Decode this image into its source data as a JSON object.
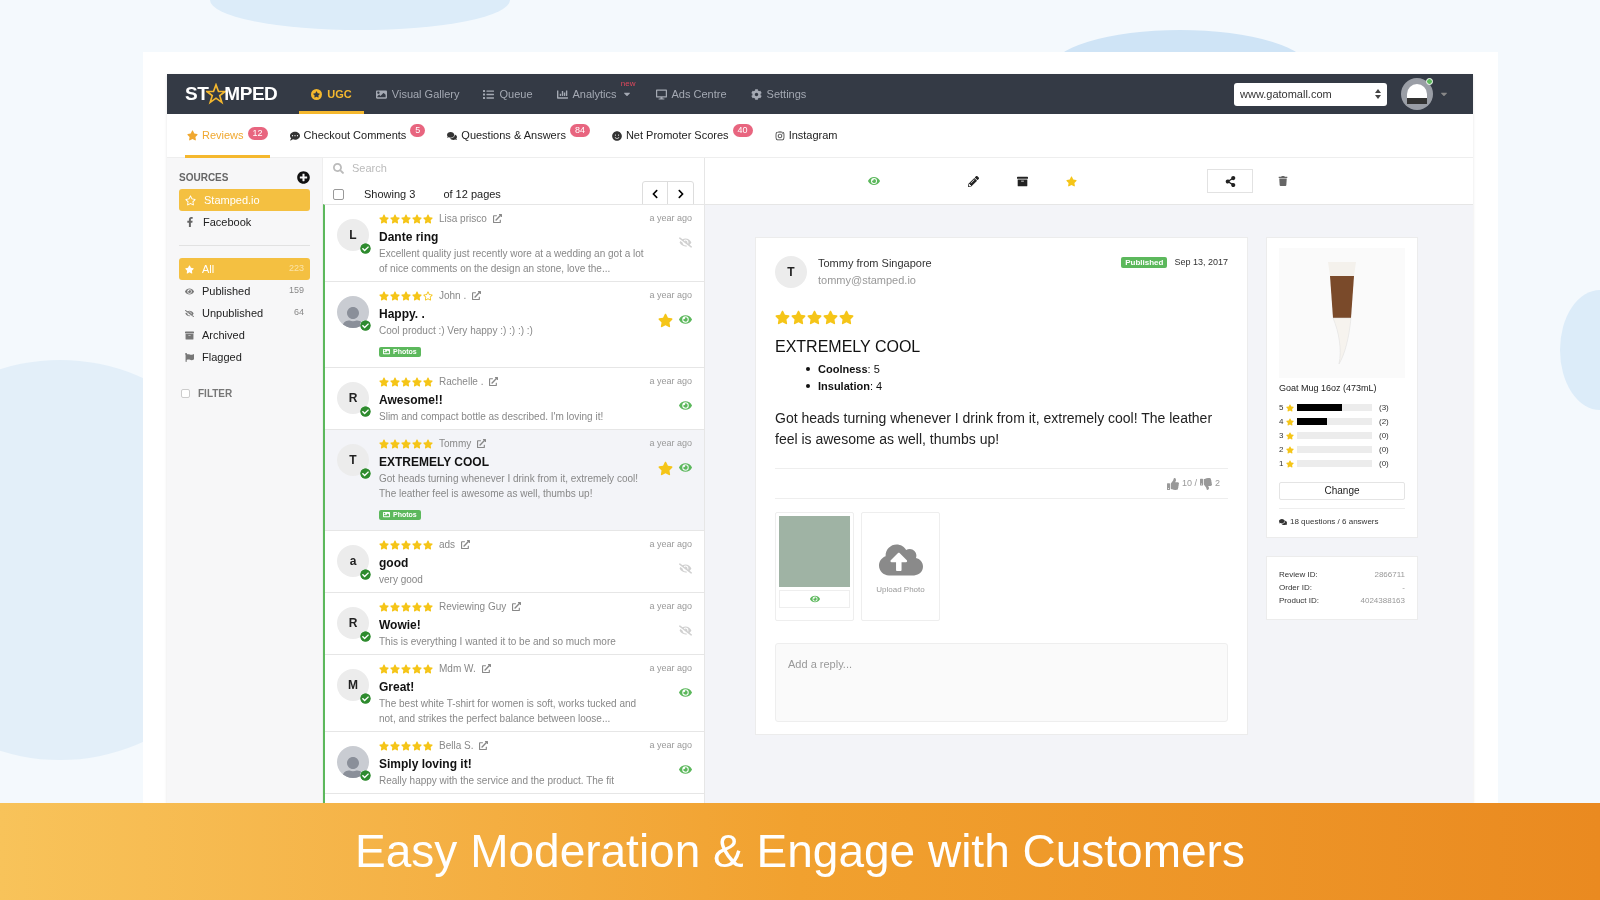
{
  "nav": {
    "logo": [
      "ST",
      "MPED"
    ],
    "items": [
      {
        "label": "UGC",
        "selected": true
      },
      {
        "label": "Visual Gallery",
        "selected": false
      },
      {
        "label": "Queue",
        "selected": false
      },
      {
        "label": "Analytics",
        "selected": false,
        "badge": "new",
        "dropdown": true
      },
      {
        "label": "Ads Centre",
        "selected": false
      },
      {
        "label": "Settings",
        "selected": false
      }
    ],
    "store": "www.gatomall.com"
  },
  "subtabs": [
    {
      "label": "Reviews",
      "count": "12",
      "selected": true
    },
    {
      "label": "Checkout Comments",
      "count": "5",
      "selected": false
    },
    {
      "label": "Questions & Answers",
      "count": "84",
      "selected": false
    },
    {
      "label": "Net Promoter Scores",
      "count": "40",
      "selected": false
    },
    {
      "label": "Instagram",
      "selected": false
    }
  ],
  "sidebar": {
    "sources_heading": "SOURCES",
    "sources": [
      {
        "label": "Stamped.io",
        "selected": true
      },
      {
        "label": "Facebook",
        "selected": false
      }
    ],
    "filters": [
      {
        "label": "All",
        "count": "223",
        "selected": true
      },
      {
        "label": "Published",
        "count": "159",
        "selected": false
      },
      {
        "label": "Unpublished",
        "count": "64",
        "selected": false
      },
      {
        "label": "Archived",
        "selected": false
      },
      {
        "label": "Flagged",
        "selected": false
      }
    ],
    "filter_toggle": {
      "label": "FILTER",
      "checked": false
    }
  },
  "list": {
    "search_placeholder": "Search",
    "select_all_checked": false,
    "showing": "Showing 3",
    "pages": "of 12 pages",
    "reviews": [
      {
        "avatar": {
          "kind": "initial",
          "initial": "L"
        },
        "stars": 5,
        "name": "Lisa prisco",
        "time": "a year ago",
        "title": "Dante ring",
        "body": "Excellent quality just recently wore at a wedding an got a lot of nice comments on the design an stone, love the...",
        "published": false,
        "featured": false,
        "selected": false
      },
      {
        "avatar": {
          "kind": "photo"
        },
        "stars": 4,
        "name": "John .",
        "time": "a year ago",
        "title": "Happy. .",
        "body": "Cool product :) Very happy :) :) :) :)",
        "photos": "Photos",
        "published": true,
        "featured": true,
        "selected": false
      },
      {
        "avatar": {
          "kind": "initial",
          "initial": "R"
        },
        "stars": 5,
        "name": "Rachelle .",
        "time": "a year ago",
        "title": "Awesome!!",
        "body": "Slim and compact bottle as described. I'm loving it!",
        "published": true,
        "featured": false,
        "selected": false
      },
      {
        "avatar": {
          "kind": "initial",
          "initial": "T"
        },
        "stars": 5,
        "name": "Tommy",
        "time": "a year ago",
        "title": "EXTREMELY COOL",
        "body": "Got heads turning whenever I drink from it, extremely cool! The leather feel is awesome as well, thumbs up!",
        "photos": "Photos",
        "published": true,
        "featured": true,
        "selected": true
      },
      {
        "avatar": {
          "kind": "initial",
          "initial": "a"
        },
        "stars": 5,
        "name": "ads",
        "time": "a year ago",
        "title": "good",
        "body": "very good",
        "published": false,
        "featured": false,
        "selected": false
      },
      {
        "avatar": {
          "kind": "initial",
          "initial": "R"
        },
        "stars": 5,
        "name": "Reviewing Guy",
        "time": "a year ago",
        "title": "Wowie!",
        "body": "This is everything I wanted it to be and so much more",
        "published": false,
        "featured": false,
        "selected": false
      },
      {
        "avatar": {
          "kind": "initial",
          "initial": "M"
        },
        "stars": 5,
        "name": "Mdm W.",
        "time": "a year ago",
        "title": "Great!",
        "body": "The best white T-shirt for women is soft, works tucked and not, and strikes the perfect balance between loose...",
        "published": true,
        "featured": false,
        "selected": false
      },
      {
        "avatar": {
          "kind": "photo"
        },
        "stars": 5,
        "name": "Bella S.",
        "time": "a year ago",
        "title": "Simply loving it!",
        "body": "Really happy with the service and the product. The fit",
        "published": true,
        "featured": false,
        "selected": false
      }
    ]
  },
  "detail": {
    "toolbar": {
      "published": true,
      "featured": true
    },
    "reviewer_initial": "T",
    "reviewer": "Tommy from Singapore",
    "email": "tommy@stamped.io",
    "status": "Published",
    "date": "Sep 13, 2017",
    "stars": 5,
    "title": "EXTREMELY COOL",
    "attributes": [
      "**Coolness**: 5",
      "**Insulation**: 4"
    ],
    "body": "Got heads turning whenever I drink from it, extremely cool! The leather feel is awesome as well, thumbs up!",
    "votes_up": "10 /",
    "votes_down": "2",
    "photo_published": true,
    "upload_label": "Upload Photo",
    "reply_placeholder": "Add a reply..."
  },
  "product": {
    "name": "Goat Mug 16oz (473mL)",
    "ratings": [
      {
        "star": "5",
        "level": 0.6,
        "count": "(3)"
      },
      {
        "star": "4",
        "level": 0.4,
        "count": "(2)"
      },
      {
        "star": "3",
        "level": 0,
        "count": "(0)"
      },
      {
        "star": "2",
        "level": 0,
        "count": "(0)"
      },
      {
        "star": "1",
        "level": 0,
        "count": "(0)"
      }
    ],
    "change": "Change",
    "questions": "18 questions / 6 answers"
  },
  "ids": [
    {
      "label": "Review ID:",
      "value": "2866711"
    },
    {
      "label": "Order ID:",
      "value": "-"
    },
    {
      "label": "Product ID:",
      "value": "4024388163"
    }
  ],
  "banner": "Easy Moderation & Engage with Customers"
}
